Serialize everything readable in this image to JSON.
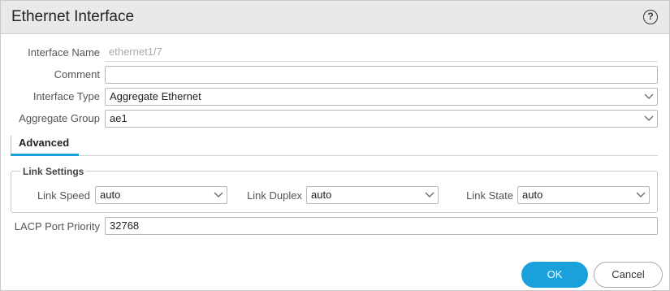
{
  "dialog": {
    "title": "Ethernet Interface",
    "help_icon": "question-circle-icon"
  },
  "form": {
    "interface_name": {
      "label": "Interface Name",
      "value": "ethernet1/7"
    },
    "comment": {
      "label": "Comment",
      "value": ""
    },
    "interface_type": {
      "label": "Interface Type",
      "value": "Aggregate Ethernet"
    },
    "aggregate_group": {
      "label": "Aggregate Group",
      "value": "ae1"
    }
  },
  "tabs": [
    {
      "label": "Advanced",
      "active": true
    }
  ],
  "link_settings": {
    "legend": "Link Settings",
    "speed": {
      "label": "Link Speed",
      "value": "auto"
    },
    "duplex": {
      "label": "Link Duplex",
      "value": "auto"
    },
    "state": {
      "label": "Link State",
      "value": "auto"
    }
  },
  "lacp": {
    "label": "LACP Port Priority",
    "value": "32768"
  },
  "buttons": {
    "ok": "OK",
    "cancel": "Cancel"
  },
  "colors": {
    "accent": "#1aa1dc",
    "titlebar": "#e9e9e9"
  }
}
